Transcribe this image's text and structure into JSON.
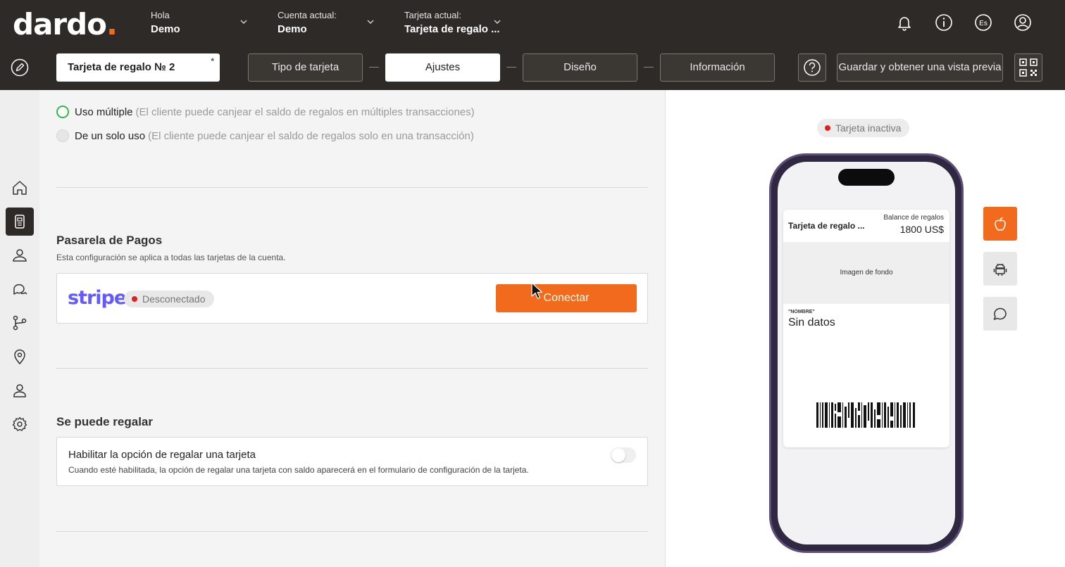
{
  "header": {
    "logo": "dardo",
    "logo_dot": ".",
    "greeting_label": "Hola",
    "greeting_user": "Demo",
    "account_label": "Cuenta actual:",
    "account_value": "Demo",
    "card_label": "Tarjeta actual:",
    "card_value": "Tarjeta de regalo ...",
    "icons": [
      "bell-icon",
      "info-icon",
      "language-icon",
      "user-icon"
    ],
    "language_code": "Es"
  },
  "toolbar": {
    "card_name": "Tarjeta de regalo № 2",
    "card_name_marker": "*",
    "steps": [
      "Tipo de tarjeta",
      "Ajustes",
      "Diseño",
      "Información"
    ],
    "active_step": "Ajustes",
    "save_label": "Guardar y obtener una vista previa"
  },
  "sidebar": {
    "items": [
      "home-icon",
      "cards-icon",
      "clients-icon",
      "chat-icon",
      "flow-icon",
      "location-icon",
      "user-icon",
      "settings-icon"
    ],
    "active": "cards-icon"
  },
  "usage": {
    "options": [
      {
        "label": "Uso múltiple",
        "hint": "(El cliente puede canjear el saldo de regalos en múltiples transacciones)",
        "selected": true
      },
      {
        "label": "De un solo uso",
        "hint": "(El cliente puede canjear el saldo de regalos solo en una transacción)",
        "selected": false
      }
    ]
  },
  "payments": {
    "title": "Pasarela de Pagos",
    "description": "Esta configuración se aplica a todas las tarjetas de la cuenta.",
    "provider": "stripe",
    "status": "Desconectado",
    "connect_label": "Conectar"
  },
  "gifting": {
    "title": "Se puede regalar",
    "option_title": "Habilitar la opción de regalar una tarjeta",
    "option_desc": "Cuando esté habilitada, la opción de regalar una tarjeta con saldo aparecerá en el formulario de configuración de la tarjeta.",
    "enabled": false
  },
  "preview": {
    "status": "Tarjeta inactiva",
    "pass": {
      "name": "Tarjeta de regalo ...",
      "balance_label": "Balance de regalos",
      "balance_value": "1800 US$",
      "background_label": "Imagen de fondo",
      "field_label": "\"NOMBRE\"",
      "field_value": "Sin datos"
    },
    "platform_buttons": [
      "apple-icon",
      "android-icon",
      "message-icon"
    ],
    "active_platform": "apple-icon"
  },
  "colors": {
    "accent": "#f26a1b",
    "header_bg": "#2e2a27",
    "stripe": "#635bff",
    "radio_selected": "#2dbb4e",
    "status_red": "#e02020",
    "phone_frame": "#5b4d77"
  }
}
